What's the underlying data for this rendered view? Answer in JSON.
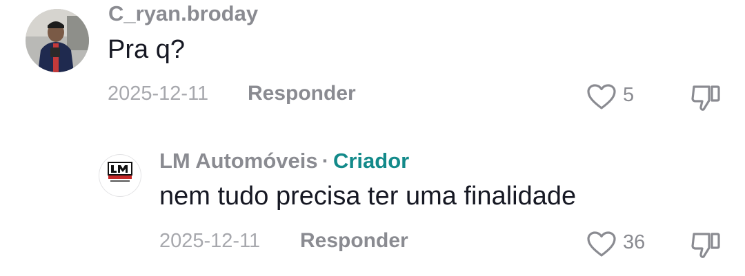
{
  "comments": [
    {
      "username": "C_ryan.broday",
      "text": "Pra q?",
      "date": "2025-12-11",
      "reply_label": "Responder",
      "likes": "5",
      "avatar_icon": "user-photo-avatar",
      "like_icon": "heart-outline-icon",
      "dislike_icon": "thumbs-down-icon"
    },
    {
      "username": "LM Automóveis",
      "separator": "·",
      "badge": "Criador",
      "text": "nem tudo precisa ter uma finalidade",
      "date": "2025-12-11",
      "reply_label": "Responder",
      "likes": "36",
      "avatar_icon": "lm-automoveis-logo",
      "like_icon": "heart-outline-icon",
      "dislike_icon": "thumbs-down-icon"
    }
  ],
  "colors": {
    "username": "#8a8b91",
    "meta": "#a7a8ad",
    "text": "#161823",
    "creator_badge": "#138a8a",
    "icon": "#8a8b91"
  }
}
